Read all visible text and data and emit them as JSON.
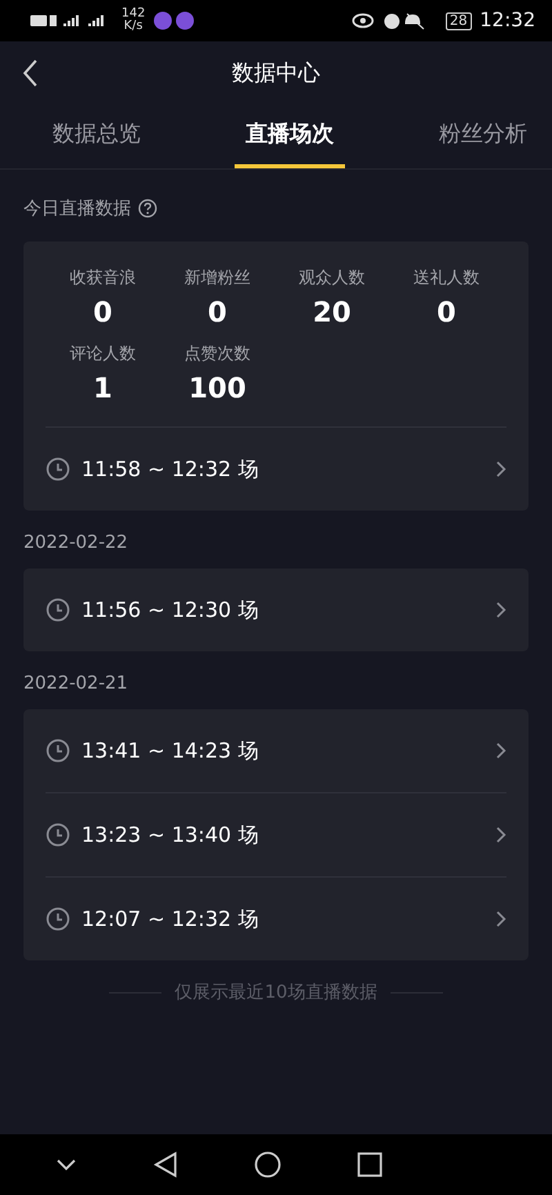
{
  "status_bar": {
    "speed": "142",
    "speed_unit": "K/s",
    "battery": "28",
    "time": "12:32"
  },
  "header": {
    "title": "数据中心"
  },
  "tabs": [
    {
      "label": "数据总览",
      "selected": false
    },
    {
      "label": "直播场次",
      "selected": true
    },
    {
      "label": "粉丝分析",
      "selected": false
    }
  ],
  "today": {
    "title": "今日直播数据",
    "stats": [
      {
        "label": "收获音浪",
        "value": "0"
      },
      {
        "label": "新增粉丝",
        "value": "0"
      },
      {
        "label": "观众人数",
        "value": "20"
      },
      {
        "label": "送礼人数",
        "value": "0"
      },
      {
        "label": "评论人数",
        "value": "1"
      },
      {
        "label": "点赞次数",
        "value": "100"
      }
    ],
    "sessions": [
      "11:58 ~ 12:32 场"
    ]
  },
  "groups": [
    {
      "date": "2022-02-22",
      "sessions": [
        "11:56 ~ 12:30 场"
      ]
    },
    {
      "date": "2022-02-21",
      "sessions": [
        "13:41 ~ 14:23 场",
        "13:23 ~ 13:40 场",
        "12:07 ~ 12:32 场"
      ]
    }
  ],
  "footer": "仅展示最近10场直播数据"
}
